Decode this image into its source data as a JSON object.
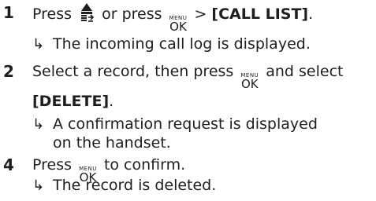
{
  "steps": [
    {
      "number": "1",
      "text_before_icon": "Press",
      "text_or_press": "or press",
      "gt": ">",
      "menu_key": {
        "top": "MENU",
        "bottom": "OK"
      },
      "bold": "[CALL LIST]",
      "end": ".",
      "result": "The incoming call log is displayed."
    },
    {
      "number": "2",
      "text": "Select a record, then press",
      "menu_key": {
        "top": "MENU",
        "bottom": "OK"
      },
      "text_after": "and select",
      "bold": "[DELETE]",
      "end": ".",
      "result_line1": "A confirmation request is displayed",
      "result_line2": "on the handset."
    },
    {
      "number": "4",
      "text_before": "Press",
      "menu_key": {
        "top": "MENU",
        "bottom": "OK"
      },
      "text_after": "to confirm.",
      "result": "The record is deleted."
    }
  ],
  "icons": {
    "arrow": "↳",
    "call-list-button": "call-list-icon"
  }
}
